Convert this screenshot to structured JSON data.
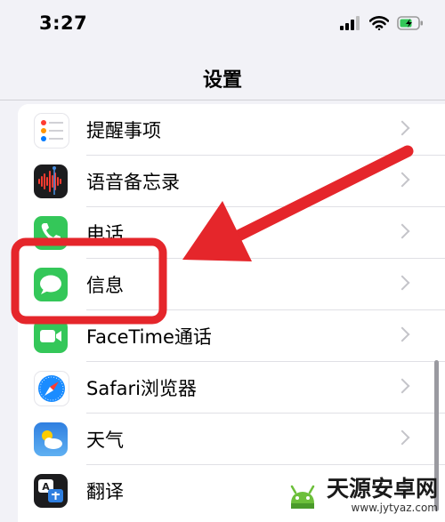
{
  "status_bar": {
    "time": "3:27",
    "icons": [
      "cellular-signal-icon",
      "wifi-icon",
      "battery-charging-icon"
    ]
  },
  "nav": {
    "title": "设置"
  },
  "settings_items": [
    {
      "label": "提醒事项",
      "icon": "reminders-icon",
      "color": "#ffffff"
    },
    {
      "label": "语音备忘录",
      "icon": "voice-memos-icon",
      "color": "#1c1c1e"
    },
    {
      "label": "电话",
      "icon": "phone-icon",
      "color": "#34c759"
    },
    {
      "label": "信息",
      "icon": "messages-icon",
      "color": "#34c759"
    },
    {
      "label": "FaceTime通话",
      "icon": "facetime-icon",
      "color": "#34c759"
    },
    {
      "label": "Safari浏览器",
      "icon": "safari-icon",
      "color": "#1a8cff"
    },
    {
      "label": "天气",
      "icon": "weather-icon",
      "color": "#3a8ee6"
    },
    {
      "label": "翻译",
      "icon": "translate-icon",
      "color": "#1c1c1e"
    }
  ],
  "annotation": {
    "highlight_color": "#e5262b",
    "highlighted_item": "信息"
  },
  "watermark": {
    "title": "天源安卓网",
    "url": "www.jytyaz.com"
  }
}
